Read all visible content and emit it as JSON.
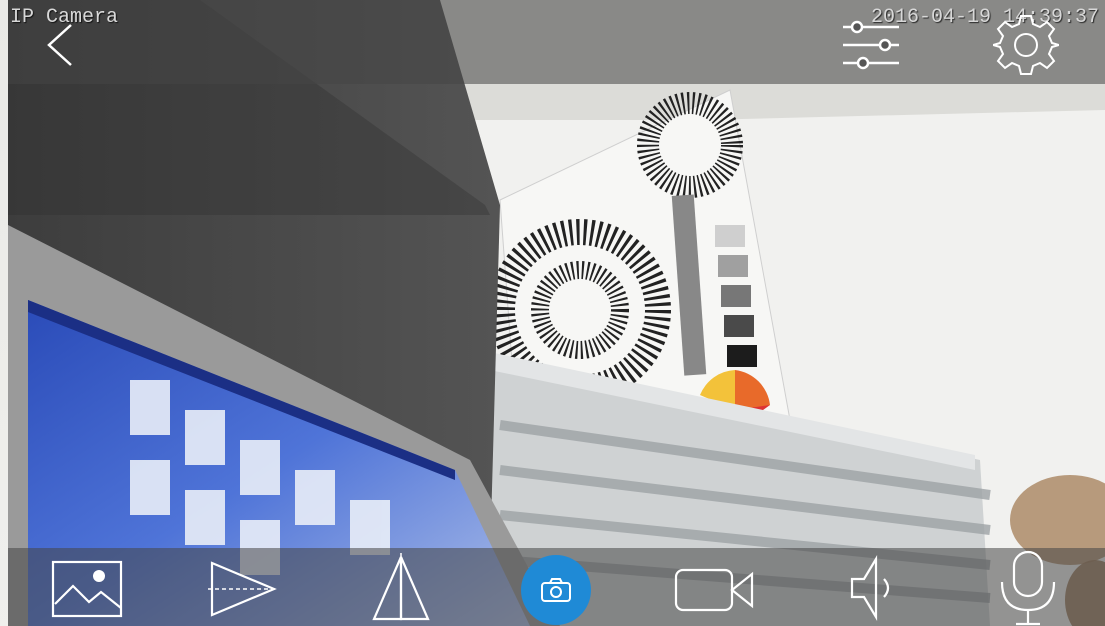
{
  "osd": {
    "title": "IP Camera",
    "timestamp": "2016-04-19 14:39:37"
  },
  "topbar": {
    "back_icon": "chevron-left-icon",
    "adjust_icon": "sliders-icon",
    "settings_icon": "gear-icon"
  },
  "bottombar": {
    "buttons": [
      {
        "icon": "image-gallery-icon"
      },
      {
        "icon": "flip-horizontal-icon"
      },
      {
        "icon": "flip-vertical-icon"
      },
      {
        "icon": "camera-snapshot-icon",
        "active": true
      },
      {
        "icon": "video-record-icon"
      },
      {
        "icon": "speaker-icon"
      },
      {
        "icon": "microphone-icon"
      }
    ]
  },
  "colors": {
    "bar_overlay": "#464646",
    "icon": "#ffffff",
    "active_button": "#1f8ad6",
    "osd_text": "#d8d8d8"
  }
}
